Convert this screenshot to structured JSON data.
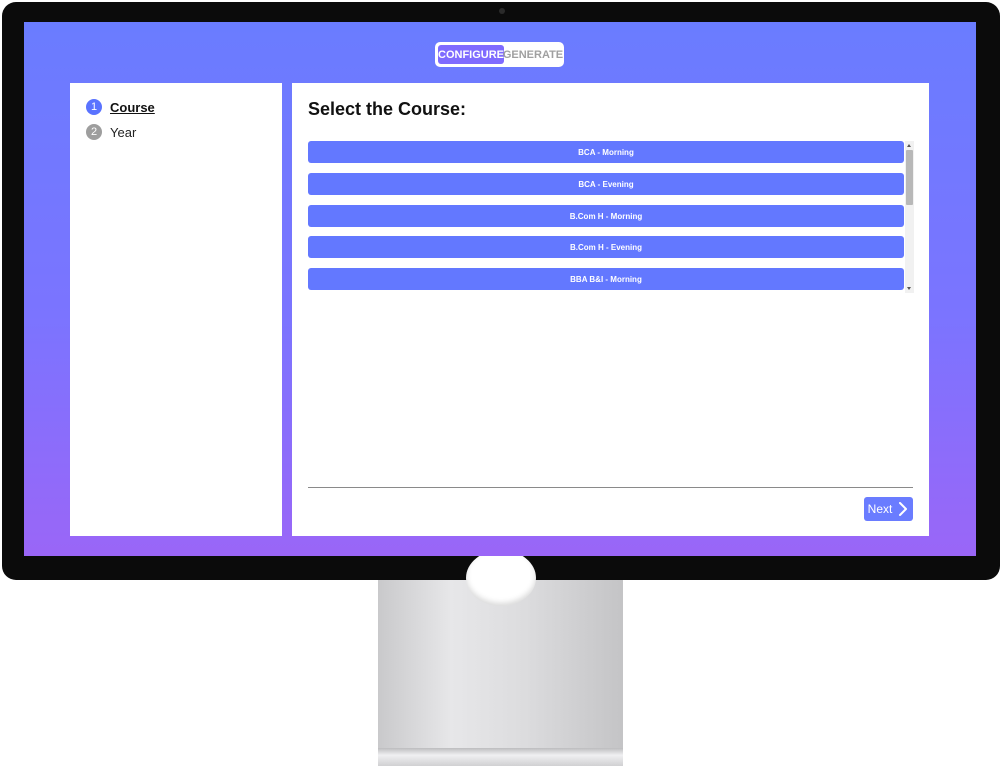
{
  "app": {
    "mode_toggle": {
      "configure_label": "CONFIGURE",
      "generate_label": "GENERATE",
      "active": "CONFIGURE"
    }
  },
  "steps": [
    {
      "number": "1",
      "label": "Course",
      "current": true
    },
    {
      "number": "2",
      "label": "Year",
      "current": false
    }
  ],
  "main": {
    "title": "Select the Course:",
    "courses": [
      "BCA - Morning",
      "BCA - Evening",
      "B.Com H - Morning",
      "B.Com H - Evening",
      "BBA B&I - Morning"
    ],
    "next_label": "Next"
  },
  "icons": {
    "next": "chevron-right-icon",
    "scroll_up": "scroll-up-arrow-icon",
    "scroll_down": "scroll-down-arrow-icon"
  },
  "colors": {
    "accent": "#6378ff",
    "toggle_active": "#7f6bff",
    "gradient_top": "#6a7cff",
    "gradient_bottom": "#9a66f7"
  }
}
